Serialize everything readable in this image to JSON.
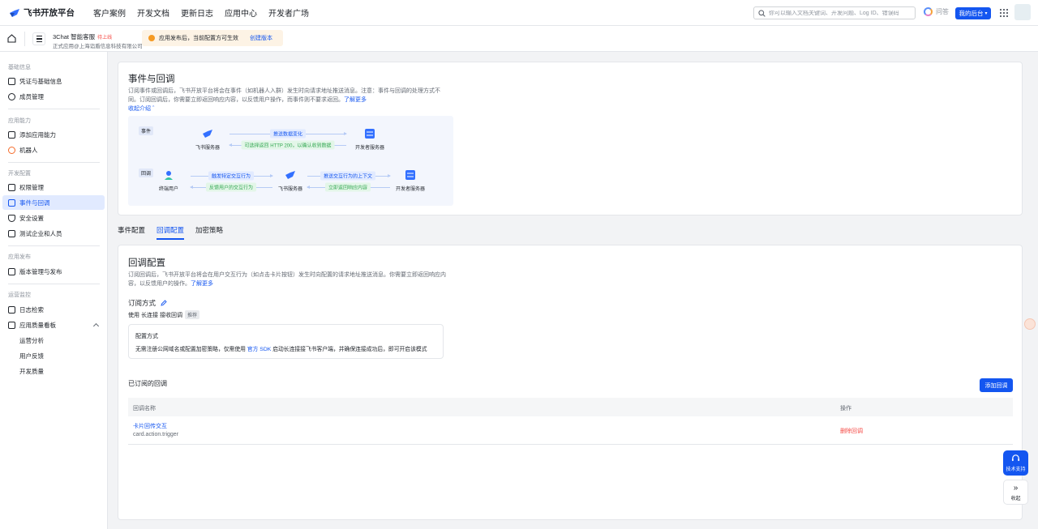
{
  "topnav": {
    "brand": "飞书开放平台",
    "items": [
      "客户案例",
      "开发文档",
      "更新日志",
      "应用中心",
      "开发者广场"
    ],
    "search_placeholder": "你可以输入文档关键词、开发问题、Log ID、错误码",
    "ask_label": "问答",
    "my_console": "我的后台"
  },
  "appbar": {
    "app_name": "3Chat 智能客服",
    "app_status": "待上线",
    "app_subtitle": "正式应用@上海诣盾信息科技有限公司",
    "notice_text": "应用发布后，当前配置方可生效",
    "notice_link": "创建版本"
  },
  "sidebar": {
    "groups": {
      "basic": "基础信息",
      "capability": "应用能力",
      "dev": "开发配置",
      "publish": "应用发布",
      "ops": "运营监控"
    },
    "items": {
      "credentials": "凭证与基础信息",
      "members": "成员管理",
      "add_capability": "添加应用能力",
      "robot": "机器人",
      "permissions": "权限管理",
      "events": "事件与回调",
      "security": "安全设置",
      "test_company": "测试企业和人员",
      "versions": "版本管理与发布",
      "logs": "日志检索",
      "quality": "应用质量看板",
      "ops_analysis": "运营分析",
      "user_feedback": "用户反馈",
      "dev_quality": "开发质量"
    }
  },
  "intro": {
    "title": "事件与回调",
    "desc_line1": "订阅事件或回调后，飞书开放平台将会在事件（如机器人入群）发生时向请求地址推送消息。注意：事件与回调的处理方式不",
    "desc_line2": "同。订阅回调后，你需要立即返回响应内容，以反馈用户操作，而事件则不要求返回。",
    "learn_more": "了解更多",
    "collapse": "收起介绍"
  },
  "flow": {
    "event_tag": "事件",
    "callback_tag": "回调",
    "feishu_server": "飞书服务器",
    "dev_server": "开发者服务器",
    "end_user": "终端用户",
    "push_change": "推送数据变化",
    "return_http": "可选择返回 HTTP 200，以确认收到数据",
    "trigger_action": "触发特定交互行为",
    "feedback_action": "反馈用户的交互行为",
    "push_context": "推送交互行为的上下文",
    "return_content": "立即返回响应内容"
  },
  "tabs": [
    "事件配置",
    "回调配置",
    "加密策略"
  ],
  "callback": {
    "title": "回调配置",
    "desc_line1": "订阅回调后，飞书开放平台将会在用户交互行为（如点击卡片按钮）发生时向配置的请求地址推送消息。你需要立即返回响应内",
    "desc_line2": "容，以反馈用户的操作。",
    "learn_more": "了解更多",
    "sub_method_label": "订阅方式",
    "use_prefix": "使用",
    "use_mode": "长连接",
    "use_suffix": "接收回调",
    "recommend_tag": "推荐",
    "config_title": "配置方式",
    "config_desc_prefix": "无需注册公网域名或配置加密策略，仅需使用",
    "config_desc_link": "官方 SDK",
    "config_desc_suffix": "启动长连接接飞书客户端，并确保连接成功后，即可开启该模式",
    "subscribed_title": "已订阅的回调",
    "add_button": "添加回调",
    "table_headers": {
      "name": "回调名称",
      "action": "操作"
    },
    "rows": [
      {
        "name": "卡片回传交互",
        "code": "card.action.trigger",
        "action": "删除回调"
      }
    ]
  },
  "floating": {
    "support": "技术支持",
    "collapse": "收起"
  },
  "colors": {
    "primary": "#1456f0",
    "danger": "#f54a45",
    "warning": "#f59a23"
  }
}
